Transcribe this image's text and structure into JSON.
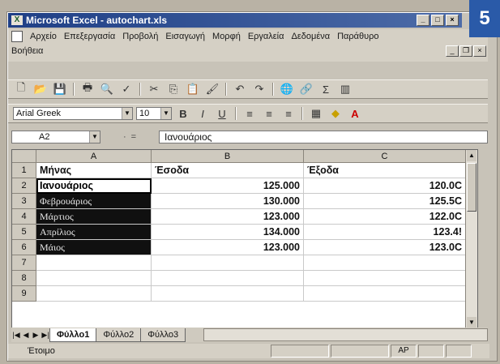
{
  "page_badge": "5",
  "window": {
    "title": "Microsoft Excel - autochart.xls",
    "app_icon": "excel-icon"
  },
  "menu": [
    "Αρχείο",
    "Επεξεργασία",
    "Προβολή",
    "Εισαγωγή",
    "Μορφή",
    "Εργαλεία",
    "Δεδομένα",
    "Παράθυρο",
    "Βοήθεια"
  ],
  "font": {
    "name": "Arial Greek",
    "size": "10"
  },
  "formula_bar": {
    "cell_ref": "A2",
    "value": "Ιανουάριος"
  },
  "columns": [
    "A",
    "B",
    "C"
  ],
  "rows": [
    {
      "num": "1",
      "a": "Μήνας",
      "b": "Έσοδα",
      "c": "Έξοδα"
    },
    {
      "num": "2",
      "a": "Ιανουάριος",
      "b": "125.000",
      "c": "120.0C"
    },
    {
      "num": "3",
      "a": "Φεβρουάριος",
      "b": "130.000",
      "c": "125.5C"
    },
    {
      "num": "4",
      "a": "Μάρτιος",
      "b": "123.000",
      "c": "122.0C"
    },
    {
      "num": "5",
      "a": "Απρίλιος",
      "b": "134.000",
      "c": "123.4!"
    },
    {
      "num": "6",
      "a": "Μάιος",
      "b": "123.000",
      "c": "123.0C"
    },
    {
      "num": "7",
      "a": "",
      "b": "",
      "c": ""
    },
    {
      "num": "8",
      "a": "",
      "b": "",
      "c": ""
    },
    {
      "num": "9",
      "a": "",
      "b": "",
      "c": ""
    }
  ],
  "sheet_tabs": [
    "Φύλλο1",
    "Φύλλο2",
    "Φύλλο3"
  ],
  "status": {
    "text": "Έτοιμο",
    "mode": "AP"
  }
}
